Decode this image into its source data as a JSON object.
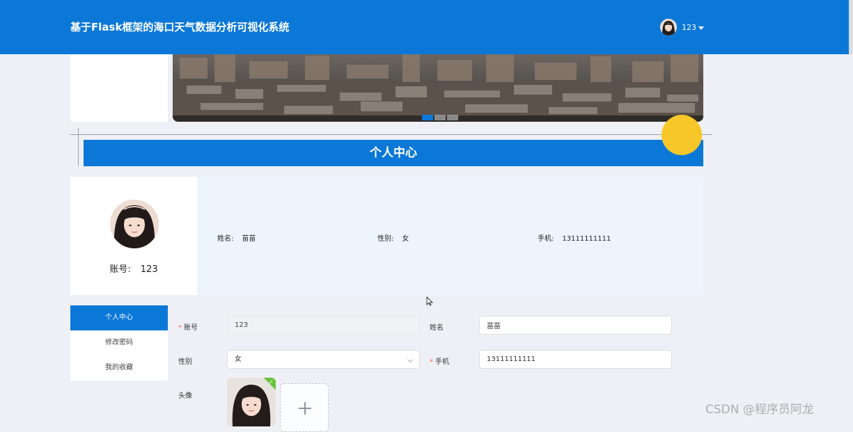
{
  "header": {
    "title": "基于Flask框架的海口天气数据分析可视化系统",
    "username": "123",
    "bg_color": "#0b78d8",
    "avatar_icon": "user-avatar-icon",
    "caret_icon": "caret-down-icon"
  },
  "banner": {
    "dot_count": 3,
    "active_dot": 1
  },
  "section": {
    "title": "个人中心"
  },
  "profile_card": {
    "account_label": "账号:",
    "account_value": "123"
  },
  "info": {
    "name_label": "姓名:",
    "name_value": "苗苗",
    "gender_label": "性别:",
    "gender_value": "女",
    "phone_label": "手机:",
    "phone_value": "13111111111"
  },
  "side_menu": {
    "items": [
      {
        "label": "个人中心",
        "active": true
      },
      {
        "label": "修改密码",
        "active": false
      },
      {
        "label": "我的收藏",
        "active": false
      }
    ]
  },
  "form": {
    "required_mark": "*",
    "account_label": "账号",
    "account_value": "123",
    "name_label": "姓名",
    "name_value": "苗苗",
    "gender_label": "性别",
    "gender_value": "女",
    "phone_label": "手机",
    "phone_value": "13111111111",
    "avatar_label": "头像",
    "upload_success_icon": "check-icon",
    "upload_add_icon": "plus-icon"
  },
  "watermark": "CSDN @程序员阿龙"
}
